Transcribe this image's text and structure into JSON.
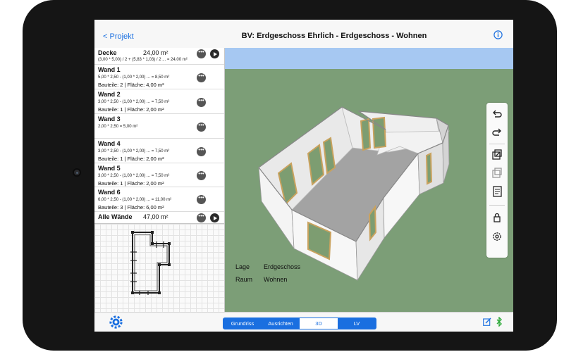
{
  "header": {
    "back_label": "< Projekt",
    "title": "BV: Erdgeschoss Ehrlich - Erdgeschoss - Wohnen"
  },
  "list": {
    "items": [
      {
        "name": "Decke",
        "area": "24,00 m²",
        "formula": "(3,00 * 5,00) / 2  + (5,83 * 1,03) / 2  ... = 24,00 m²",
        "sub": "",
        "play": true
      },
      {
        "name": "Wand 1",
        "area": "",
        "formula": "5,00 * 2,50  - (1,00 * 2,00)  ... = 8,50 m²",
        "sub": "Bauteile: 2 | Fläche: 4,00 m²",
        "play": false
      },
      {
        "name": "Wand 2",
        "area": "",
        "formula": "3,00 * 2,50  - (1,00 * 2,00) ... = 7,50 m²",
        "sub": "Bauteile: 1 | Fläche: 2,00 m²",
        "play": false
      },
      {
        "name": "Wand 3",
        "area": "",
        "formula": "2,00 * 2,50   = 5,00 m²",
        "sub": "",
        "play": false
      },
      {
        "name": "Wand 4",
        "area": "",
        "formula": "3,00 * 2,50  - (1,00 * 2,00) ... = 7,50 m²",
        "sub": "Bauteile: 1 | Fläche: 2,00 m²",
        "play": false
      },
      {
        "name": "Wand 5",
        "area": "",
        "formula": "3,00 * 2,50  - (1,00 * 2,00) ... = 7,50 m²",
        "sub": "Bauteile: 1 | Fläche: 2,00 m²",
        "play": false
      },
      {
        "name": "Wand 6",
        "area": "",
        "formula": "6,00 * 2,50  - (1,00 * 2,00) ... = 11,00 m²",
        "sub": "Bauteile: 3 | Fläche: 6,00 m²",
        "play": false
      },
      {
        "name": "Alle Wände",
        "area": "47,00 m²",
        "formula": "",
        "sub": "",
        "play": true
      }
    ]
  },
  "view": {
    "lage_label": "Lage",
    "lage_value": "Erdgeschoss",
    "raum_label": "Raum",
    "raum_value": "Wohnen"
  },
  "toolbar": {
    "icons": [
      "undo-icon",
      "redo-icon",
      "export-icon",
      "duplicate-icon",
      "notes-icon",
      "lock-icon",
      "settings-icon"
    ]
  },
  "tabs": {
    "items": [
      "Grundriss",
      "Ausrichten",
      "3D",
      "LV"
    ],
    "active": "3D"
  },
  "colors": {
    "accent": "#1a6fe0",
    "ground": "#7c9e77",
    "sky": "#a6c8f2",
    "wall": "#f1f1f1",
    "floor": "#a3a3a3",
    "window": "#7d9d71"
  }
}
